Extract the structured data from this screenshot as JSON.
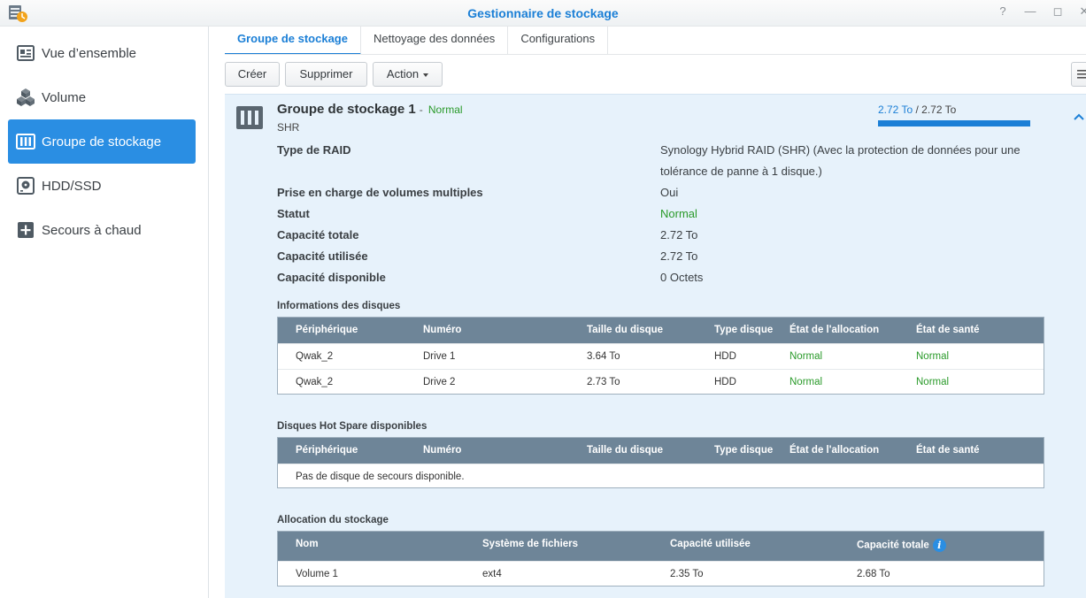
{
  "window": {
    "title": "Gestionnaire de stockage",
    "help_glyph": "?",
    "minimize_glyph": "—",
    "maximize_glyph": "◻",
    "close_glyph": "✕"
  },
  "sidebar": {
    "items": [
      {
        "label": "Vue d’ensemble",
        "icon": "overview-icon"
      },
      {
        "label": "Volume",
        "icon": "volume-cubes-icon"
      },
      {
        "label": "Groupe de stockage",
        "icon": "storage-pool-icon",
        "active": true
      },
      {
        "label": "HDD/SSD",
        "icon": "hdd-icon"
      },
      {
        "label": "Secours à chaud",
        "icon": "hot-spare-plus-icon"
      }
    ]
  },
  "tabs": [
    {
      "label": "Groupe de stockage",
      "active": true
    },
    {
      "label": "Nettoyage des données"
    },
    {
      "label": "Configurations"
    }
  ],
  "toolbar": {
    "create_label": "Créer",
    "delete_label": "Supprimer",
    "action_label": "Action"
  },
  "pool": {
    "name": "Groupe de stockage 1",
    "dash": "-",
    "status": "Normal",
    "type": "SHR",
    "usage_used": "2.72 To",
    "usage_sep": " / ",
    "usage_total": "2.72 To",
    "usage_fraction": 1.0,
    "properties": [
      {
        "label": "Type de RAID",
        "value": "Synology Hybrid RAID (SHR) (Avec la protection de données pour une tolérance de panne à 1 disque.)"
      },
      {
        "label": "Prise en charge de volumes multiples",
        "value": "Oui"
      },
      {
        "label": "Statut",
        "value": "Normal",
        "status": true
      },
      {
        "label": "Capacité totale",
        "value": "2.72 To"
      },
      {
        "label": "Capacité utilisée",
        "value": "2.72 To"
      },
      {
        "label": "Capacité disponible",
        "value": "0 Octets"
      }
    ]
  },
  "disk_info": {
    "title": "Informations des disques",
    "headers": [
      "Périphérique",
      "Numéro",
      "Taille du disque",
      "Type disque",
      "État de l'allocation",
      "État de santé"
    ],
    "rows": [
      [
        "Qwak_2",
        "Drive 1",
        "3.64 To",
        "HDD",
        "Normal",
        "Normal"
      ],
      [
        "Qwak_2",
        "Drive 2",
        "2.73 To",
        "HDD",
        "Normal",
        "Normal"
      ]
    ]
  },
  "hot_spare": {
    "title": "Disques Hot Spare disponibles",
    "headers": [
      "Périphérique",
      "Numéro",
      "Taille du disque",
      "Type disque",
      "État de l'allocation",
      "État de santé"
    ],
    "empty_message": "Pas de disque de secours disponible."
  },
  "allocation": {
    "title": "Allocation du stockage",
    "headers": [
      "Nom",
      "Système de fichiers",
      "Capacité utilisée",
      "Capacité totale"
    ],
    "info_glyph": "i",
    "rows": [
      [
        "Volume 1",
        "ext4",
        "2.35 To",
        "2.68 To"
      ]
    ]
  },
  "colors": {
    "accent": "#1b7fd6",
    "sidebar_active": "#2a8ee3",
    "status_green": "#2a9a2a",
    "table_header": "#6e8598",
    "panel_bg": "#e7f2fb"
  }
}
